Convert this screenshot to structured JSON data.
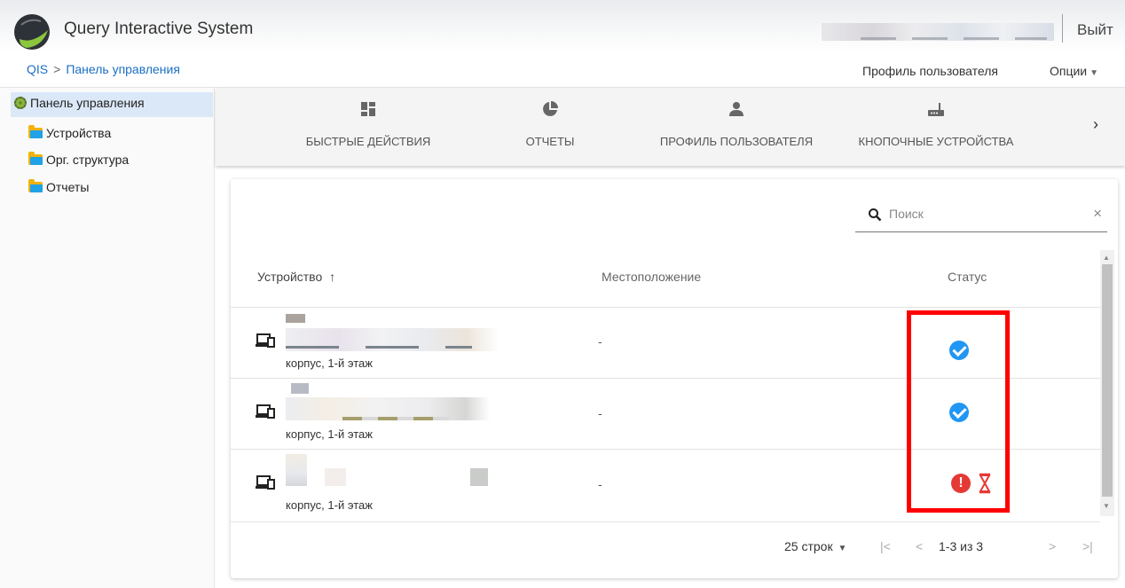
{
  "header": {
    "app_title": "Query Interactive System",
    "logout_label": "Выйт"
  },
  "breadcrumb": {
    "root": "QIS",
    "separator": ">",
    "current": "Панель управления"
  },
  "user_menu": {
    "profile_label": "Профиль пользователя",
    "options_label": "Опции"
  },
  "sidebar": {
    "root_label": "Панель управления",
    "items": [
      {
        "label": "Устройства",
        "icon": "folder-icon"
      },
      {
        "label": "Орг. структура",
        "icon": "folder-icon"
      },
      {
        "label": "Отчеты",
        "icon": "folder-icon"
      }
    ]
  },
  "toolbar": {
    "tabs": [
      {
        "label": "БЫСТРЫЕ ДЕЙСТВИЯ",
        "icon": "dashboard-icon"
      },
      {
        "label": "ОТЧЕТЫ",
        "icon": "pie-chart-icon"
      },
      {
        "label": "ПРОФИЛЬ ПОЛЬЗОВАТЕЛЯ",
        "icon": "person-icon"
      },
      {
        "label": "КНОПОЧНЫЕ УСТРОЙСТВА",
        "icon": "router-icon"
      }
    ],
    "next_icon": "chevron-right-icon"
  },
  "search": {
    "placeholder": "Поиск",
    "clear": "×"
  },
  "table": {
    "columns": [
      "Устройство",
      "Местоположение",
      "Статус"
    ],
    "sort_indicator": "↑",
    "rows": [
      {
        "subtitle": "корпус, 1-й этаж",
        "location": "-",
        "status": "ok"
      },
      {
        "subtitle": "корпус, 1-й этаж",
        "location": "-",
        "status": "ok"
      },
      {
        "subtitle": "корпус, 1-й этаж",
        "location": "-",
        "status": "error-pending"
      }
    ]
  },
  "pagination": {
    "rows_per_page": "25 строк",
    "range": "1-3 из 3",
    "first": "|<",
    "prev": "<",
    "next": ">",
    "last": ">|"
  },
  "colors": {
    "accent": "#1b6fc4",
    "status_ok": "#2196f3",
    "status_error": "#e53935",
    "highlight_box": "#ff0000"
  }
}
